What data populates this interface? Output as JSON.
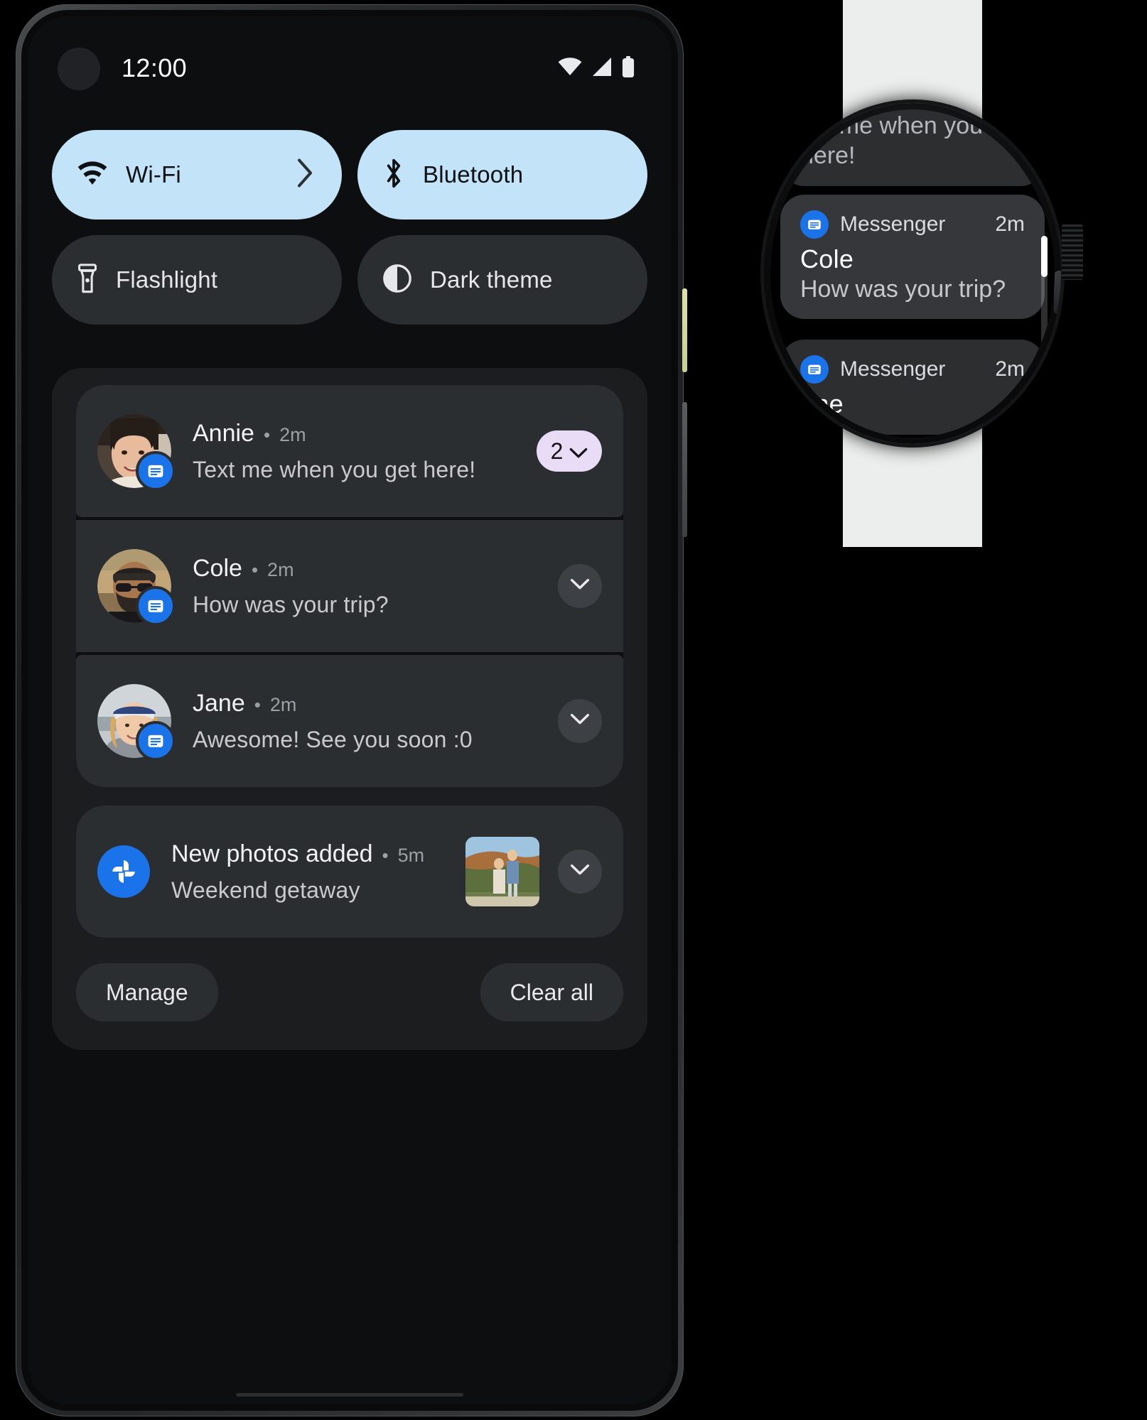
{
  "phone": {
    "status_bar": {
      "time": "12:00",
      "icons": [
        "wifi-icon",
        "cellular-signal-icon",
        "battery-icon"
      ]
    },
    "quick_settings": {
      "tiles": [
        {
          "label": "Wi-Fi",
          "icon": "wifi-icon",
          "state": "on",
          "has_chevron": true
        },
        {
          "label": "Bluetooth",
          "icon": "bluetooth-icon",
          "state": "on",
          "has_chevron": false
        },
        {
          "label": "Flashlight",
          "icon": "flashlight-icon",
          "state": "off",
          "has_chevron": false
        },
        {
          "label": "Dark theme",
          "icon": "dark-theme-icon",
          "state": "off",
          "has_chevron": false
        }
      ]
    },
    "notifications": {
      "messages": [
        {
          "sender": "Annie",
          "separator": "•",
          "time": "2m",
          "message": "Text me when you get here!",
          "app_icon": "messenger-icon",
          "count": "2",
          "expand": "chevron-down-icon"
        },
        {
          "sender": "Cole",
          "separator": "•",
          "time": "2m",
          "message": "How was your trip?",
          "app_icon": "messenger-icon",
          "count": "",
          "expand": "chevron-down-icon"
        },
        {
          "sender": "Jane",
          "separator": "•",
          "time": "2m",
          "message": "Awesome! See you soon :0",
          "app_icon": "messenger-icon",
          "count": "",
          "expand": "chevron-down-icon"
        }
      ],
      "photos": {
        "title": "New photos added",
        "separator": "•",
        "time": "5m",
        "subtitle": "Weekend getaway",
        "app_icon": "google-photos-icon",
        "thumbnail": "couple-on-hillside-photo",
        "expand": "chevron-down-icon"
      },
      "actions": {
        "manage": "Manage",
        "clear_all": "Clear all"
      }
    }
  },
  "watch": {
    "cards": [
      {
        "position": "previous",
        "preview_text": "ext me when you get here!"
      },
      {
        "position": "current",
        "app": "Messenger",
        "time": "2m",
        "sender": "Cole",
        "message": "How was your trip?",
        "app_icon": "messenger-icon"
      },
      {
        "position": "next",
        "app": "Messenger",
        "time": "2m",
        "sender": "ane",
        "message": "",
        "app_icon": "messenger-icon"
      }
    ],
    "scrollbar": "vertical-scroll-indicator"
  },
  "colors": {
    "tile_on_bg": "#c2e3f8",
    "tile_off_bg": "#2b2e31",
    "notification_bg": "#2b2e31",
    "shade_bg": "#1b1d1f",
    "badge_bg": "#e9dcf6",
    "app_accent": "#1a73e8",
    "watch_band": "#eceded",
    "screen_bg": "#0d0e10"
  }
}
